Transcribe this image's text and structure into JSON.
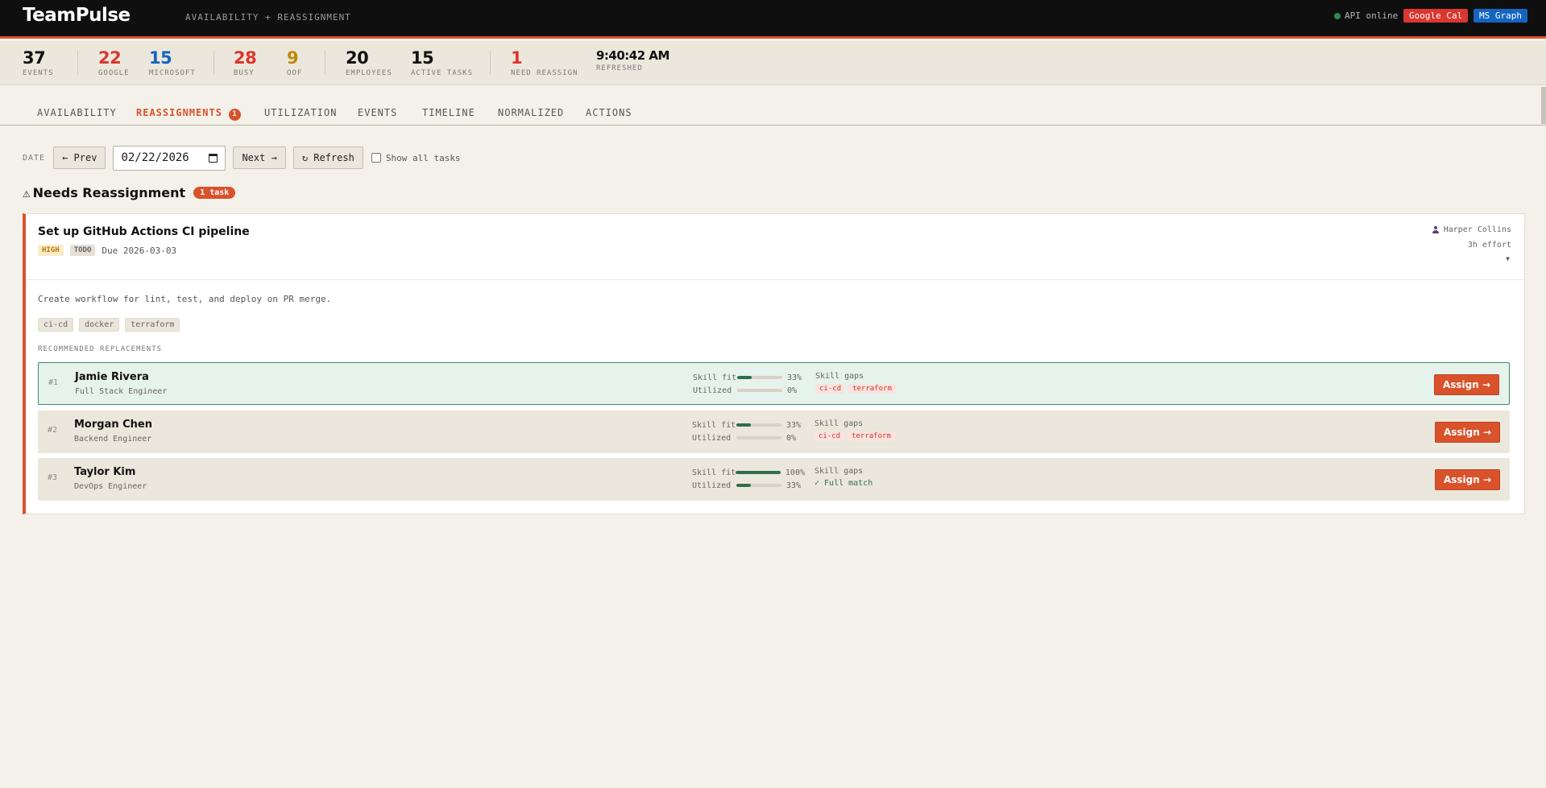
{
  "header": {
    "logo": "TeamPulse",
    "subtitle": "AVAILABILITY + REASSIGNMENT",
    "api_status": "API online",
    "google_cal": "Google Cal",
    "ms_graph": "MS Graph",
    "colors": {
      "accent": "#d9522b",
      "google": "#d9372f",
      "microsoft": "#1565c0",
      "online": "#2f8a4c"
    }
  },
  "stats": [
    {
      "value": "37",
      "label": "EVENTS",
      "color": "#111111"
    },
    {
      "value": "22",
      "label": "GOOGLE",
      "color": "#d9372f"
    },
    {
      "value": "15",
      "label": "MICROSOFT",
      "color": "#1565c0"
    },
    {
      "value": "28",
      "label": "BUSY",
      "color": "#d9372f"
    },
    {
      "value": "9",
      "label": "OOF",
      "color": "#c0870b"
    },
    {
      "value": "20",
      "label": "EMPLOYEES",
      "color": "#111111"
    },
    {
      "value": "15",
      "label": "ACTIVE TASKS",
      "color": "#111111"
    },
    {
      "value": "1",
      "label": "NEED REASSIGN",
      "color": "#d9372f"
    },
    {
      "value": "9:40:42 AM",
      "label": "REFRESHED",
      "color": "#111111"
    }
  ],
  "tabs": [
    {
      "label": "AVAILABILITY"
    },
    {
      "label": "REASSIGNMENTS",
      "badge": "1",
      "active": true
    },
    {
      "label": "UTILIZATION"
    },
    {
      "label": "EVENTS"
    },
    {
      "label": "TIMELINE"
    },
    {
      "label": "NORMALIZED"
    },
    {
      "label": "ACTIONS"
    }
  ],
  "toolbar": {
    "date_label": "DATE",
    "prev": "← Prev",
    "date_value": "02/22/2026",
    "next": "Next →",
    "refresh": "↻ Refresh",
    "show_all": "Show all tasks"
  },
  "section": {
    "icon": "⚠",
    "title": "Needs Reassignment",
    "count": "1 task"
  },
  "task": {
    "title": "Set up GitHub Actions CI pipeline",
    "priority": "HIGH",
    "status": "TODO",
    "due": "Due 2026-03-03",
    "assignee": "Harper Collins",
    "effort": "3h effort",
    "description": "Create workflow for lint, test, and deploy on PR merge.",
    "skills": [
      "ci-cd",
      "docker",
      "terraform"
    ],
    "rec_label": "RECOMMENDED REPLACEMENTS"
  },
  "candidates": [
    {
      "rank": "#1",
      "name": "Jamie Rivera",
      "role": "Full Stack Engineer",
      "skill_fit_label": "Skill fit",
      "skill_fit": 33,
      "skill_fit_text": "33%",
      "utilized_label": "Utilized",
      "utilized": 0,
      "utilized_text": "0%",
      "gaps_title": "Skill gaps",
      "gaps": [
        "ci-cd",
        "terraform"
      ],
      "full_match": "",
      "assign": "Assign →"
    },
    {
      "rank": "#2",
      "name": "Morgan Chen",
      "role": "Backend Engineer",
      "skill_fit_label": "Skill fit",
      "skill_fit": 33,
      "skill_fit_text": "33%",
      "utilized_label": "Utilized",
      "utilized": 0,
      "utilized_text": "0%",
      "gaps_title": "Skill gaps",
      "gaps": [
        "ci-cd",
        "terraform"
      ],
      "full_match": "",
      "assign": "Assign →"
    },
    {
      "rank": "#3",
      "name": "Taylor Kim",
      "role": "DevOps Engineer",
      "skill_fit_label": "Skill fit",
      "skill_fit": 100,
      "skill_fit_text": "100%",
      "utilized_label": "Utilized",
      "utilized": 33,
      "utilized_text": "33%",
      "gaps_title": "Skill gaps",
      "gaps": [],
      "full_match": "✓ Full match",
      "assign": "Assign →"
    }
  ]
}
